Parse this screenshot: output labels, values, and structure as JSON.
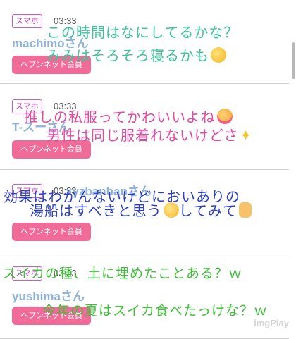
{
  "posts": [
    {
      "badge": "スマホ",
      "time": "03:33",
      "username": "machimoさん",
      "member_label": "ヘブンネット会員",
      "overlay_line1": "この時間はなにしてるかな？",
      "overlay_line2": "みみはそろそろ寝るかも",
      "overlay_color": "#3fc39a",
      "emoji": "sleepy-face-icon"
    },
    {
      "badge": "スマホ",
      "time": "03:33",
      "username": "T-スーさん",
      "member_label": "ヘブンネット会員",
      "overlay_line1": "推しの私服ってかわいいよね",
      "overlay_line2": "男性は同じ服着れないけどさ",
      "overlay_color": "#e14aa0",
      "emoji": "smiling-face-with-hearts-icon"
    },
    {
      "badge": "スマホ",
      "time": "03:33",
      "username": "xyzbanbanさん",
      "member_label": "ヘブンネット会員",
      "overlay_line1": "効果はわかんないけどにおいありの",
      "overlay_line2": "湯船はすべきと思う",
      "overlay_line2b": "してみて",
      "overlay_color": "#2b3fc4",
      "emoji": "smiling-face-icon"
    },
    {
      "badge": "スマホ",
      "time": "03:33",
      "username": "yushimaさん",
      "member_label": "ヘブンネット会員",
      "overlay_line1": "スイカの種、土に埋めたことある？ｗ",
      "overlay_line2": "今年の夏はスイカ食べたっけな？ｗ",
      "overlay_color": "#3fbf3a"
    }
  ],
  "watermark": "imgPlay"
}
